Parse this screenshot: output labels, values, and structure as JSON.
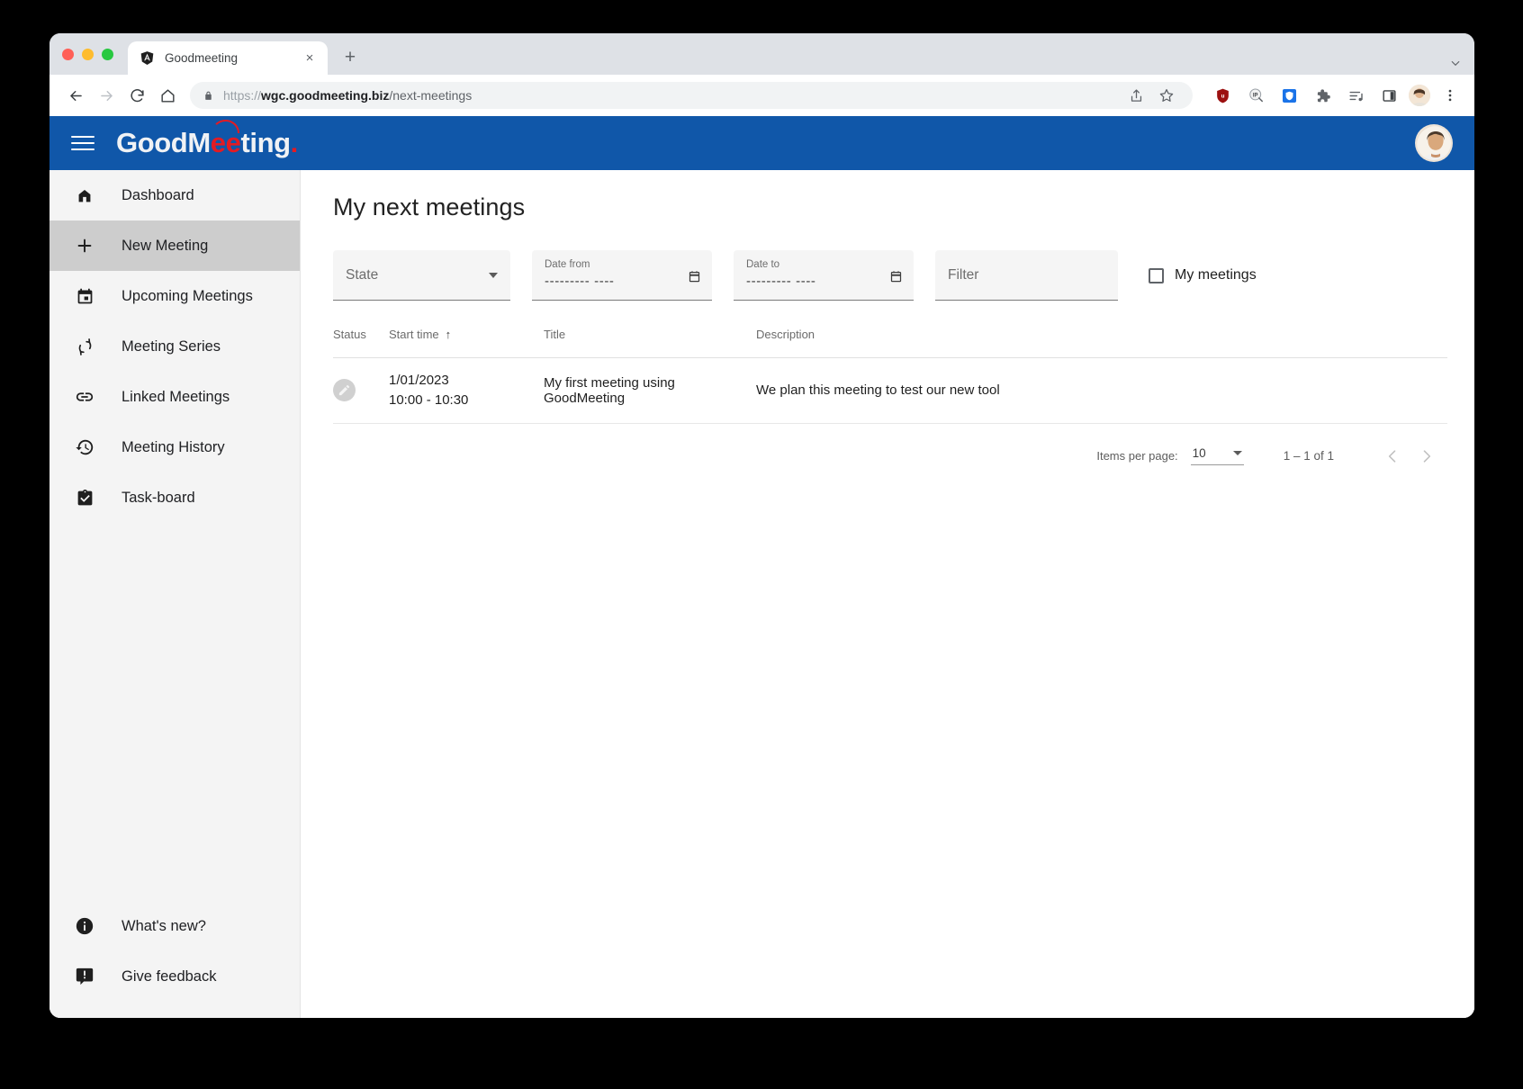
{
  "browser": {
    "tab": {
      "title": "Goodmeeting",
      "favicon": "angular-logo-icon",
      "close_label": "×"
    },
    "new_tab_label": "+",
    "window_controls": [
      "close",
      "minimize",
      "maximize"
    ],
    "nav": {
      "back": "←",
      "forward": "→",
      "reload": "↻",
      "home": "⌂"
    },
    "omnibox": {
      "scheme": "https://",
      "host": "wgc.goodmeeting.biz",
      "path": "/next-meetings",
      "full_url": "https://wgc.goodmeeting.biz/next-meetings",
      "lock": "lock-icon"
    },
    "extensions": [
      "share-icon",
      "bookmark-star-icon",
      "ublock-origin-icon",
      "ip-lookup-icon",
      "blue-shield-icon",
      "puzzle-extensions-icon",
      "reading-list-icon",
      "side-panel-icon",
      "profile-avatar",
      "chrome-menu-icon"
    ]
  },
  "app": {
    "logo": {
      "part1": "GoodM",
      "accent": "ee",
      "part2": "ting",
      "dot": "."
    },
    "menu_button": "hamburger-menu-icon",
    "avatar": "user-avatar",
    "brand_color": "#1057a9",
    "accent_color": "#e31b23"
  },
  "sidebar": {
    "items": [
      {
        "label": "Dashboard",
        "icon": "home-icon",
        "active": false
      },
      {
        "label": "New Meeting",
        "icon": "plus-icon",
        "active": true
      },
      {
        "label": "Upcoming Meetings",
        "icon": "calendar-icon",
        "active": false
      },
      {
        "label": "Meeting Series",
        "icon": "repeat-icon",
        "active": false
      },
      {
        "label": "Linked Meetings",
        "icon": "link-icon",
        "active": false
      },
      {
        "label": "Meeting History",
        "icon": "history-icon",
        "active": false
      },
      {
        "label": "Task-board",
        "icon": "clipboard-check-icon",
        "active": false
      }
    ],
    "bottom_items": [
      {
        "label": "What's new?",
        "icon": "info-icon"
      },
      {
        "label": "Give feedback",
        "icon": "feedback-icon"
      }
    ]
  },
  "main": {
    "title": "My next meetings",
    "filters": {
      "state": {
        "label": "State",
        "value": "",
        "placeholder": "State"
      },
      "date_from": {
        "label": "Date from",
        "value": "--------- ----"
      },
      "date_to": {
        "label": "Date to",
        "value": "--------- ----"
      },
      "filter": {
        "label": "Filter",
        "placeholder": "Filter",
        "value": ""
      },
      "my_meetings": {
        "label": "My meetings",
        "checked": false
      }
    },
    "table": {
      "columns": [
        "Status",
        "Start time",
        "Title",
        "Description"
      ],
      "sorted_column": "Start time",
      "sort_direction": "↑",
      "rows": [
        {
          "status_icon": "edit-pencil-icon",
          "date": "1/01/2023",
          "time": "10:00 - 10:30",
          "title": "My first meeting using GoodMeeting",
          "description": "We plan this meeting to test our new tool"
        }
      ]
    },
    "paginator": {
      "items_per_page_label": "Items per page:",
      "items_per_page_value": "10",
      "range": "1 – 1 of 1",
      "prev_label": "‹",
      "next_label": "›"
    }
  }
}
